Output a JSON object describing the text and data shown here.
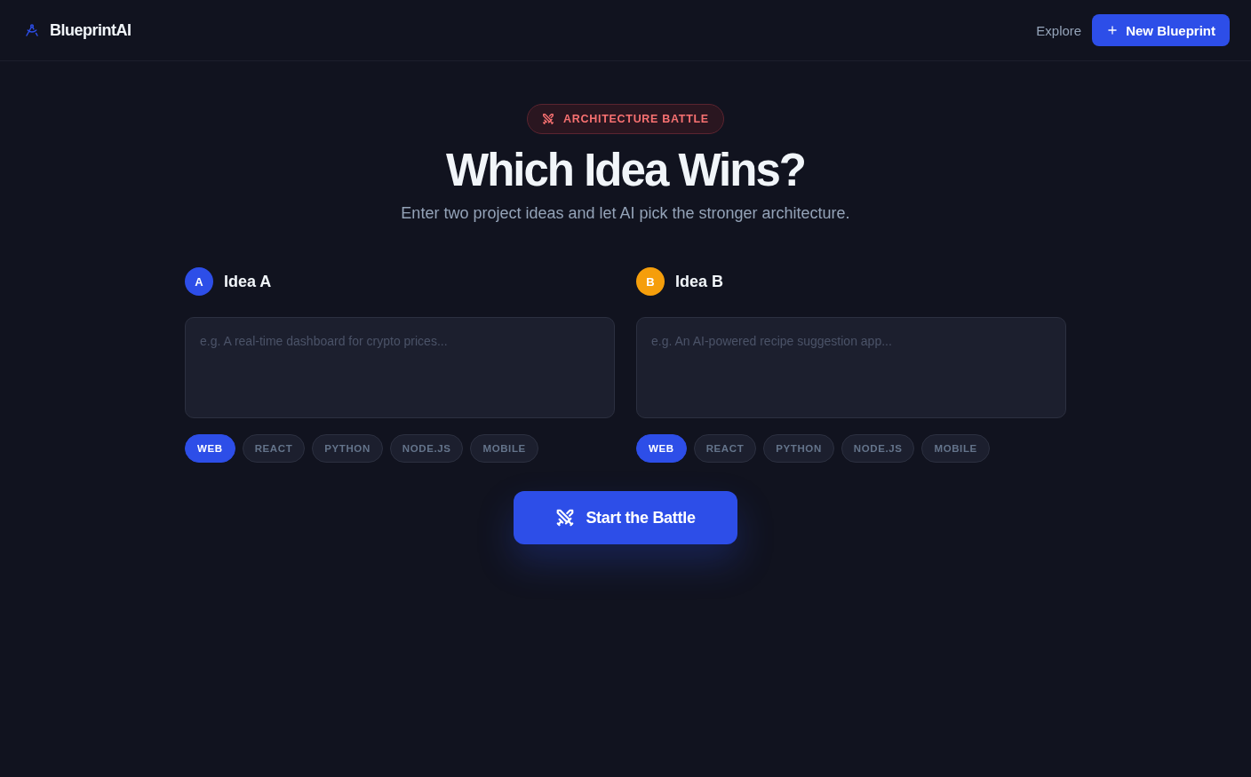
{
  "header": {
    "logo": "BlueprintAI",
    "nav": [
      {
        "label": "Explore"
      }
    ],
    "new_button": {
      "label": "New Blueprint"
    }
  },
  "hero": {
    "badge": "ARCHITECTURE BATTLE",
    "title": "Which Idea Wins?",
    "subtitle": "Enter two project ideas and let AI pick the stronger architecture."
  },
  "ideas": [
    {
      "letter": "A",
      "title": "Idea A",
      "color": "#2d4ee8",
      "placeholder": "e.g. A real-time dashboard for crypto prices...",
      "tags": [
        {
          "label": "WEB",
          "selected": true
        },
        {
          "label": "REACT",
          "selected": false
        },
        {
          "label": "PYTHON",
          "selected": false
        },
        {
          "label": "NODE.JS",
          "selected": false
        },
        {
          "label": "MOBILE",
          "selected": false
        }
      ]
    },
    {
      "letter": "B",
      "title": "Idea B",
      "color": "#f59e0b",
      "placeholder": "e.g. An AI-powered recipe suggestion app...",
      "tags": [
        {
          "label": "WEB",
          "selected": true
        },
        {
          "label": "REACT",
          "selected": false
        },
        {
          "label": "PYTHON",
          "selected": false
        },
        {
          "label": "NODE.JS",
          "selected": false
        },
        {
          "label": "MOBILE",
          "selected": false
        }
      ]
    }
  ],
  "action": {
    "label": "Start the Battle"
  }
}
